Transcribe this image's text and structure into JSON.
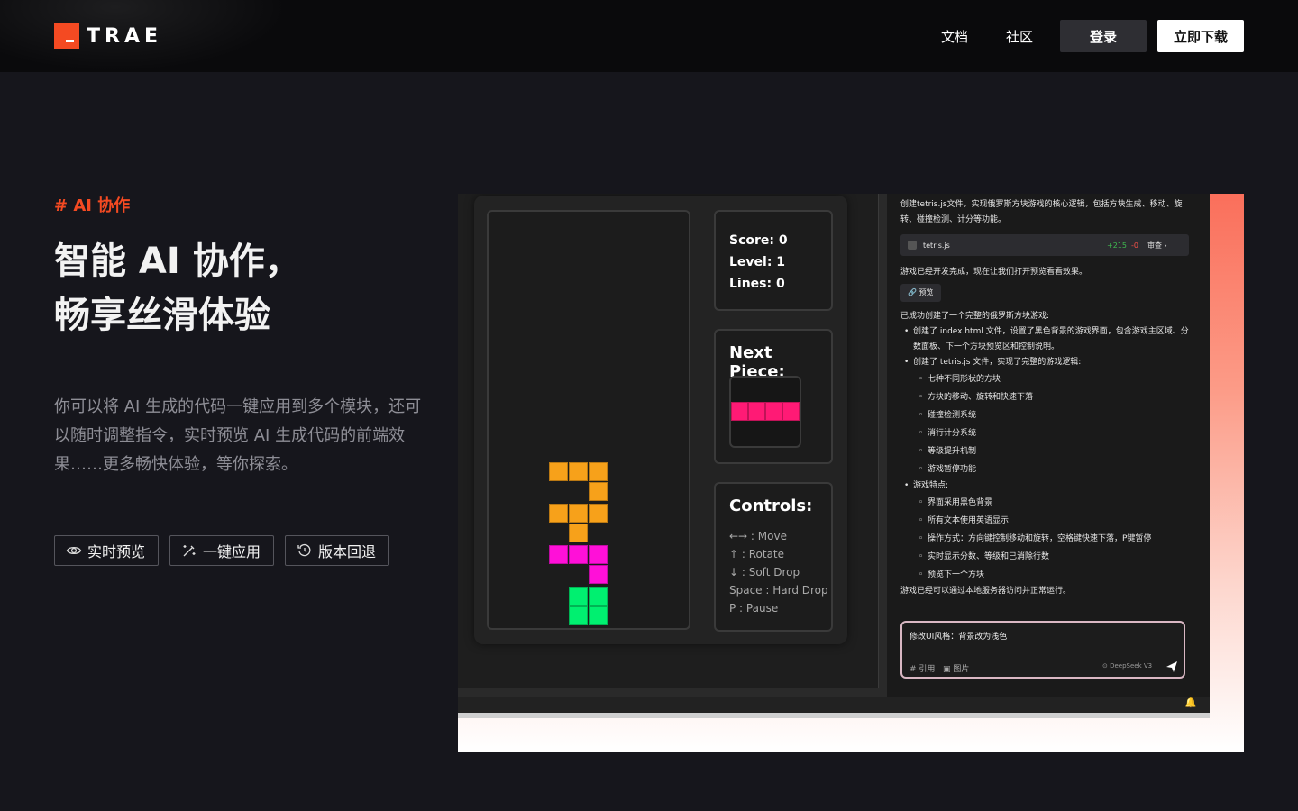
{
  "header": {
    "logo_text": "TRAE",
    "nav": [
      "文档",
      "社区"
    ],
    "login_label": "登录",
    "download_label": "立即下载",
    "brand_color": "#f44a22"
  },
  "hero": {
    "tag": "# AI 协作",
    "title_line1": "智能 AI 协作，",
    "title_line2": "畅享丝滑体验",
    "description": "你可以将 AI 生成的代码一键应用到多个模块，还可以随时调整指令，实时预览 AI 生成代码的前端效果……更多畅快体验，等你探索。",
    "features": [
      {
        "label": "实时预览",
        "icon": "eye-icon"
      },
      {
        "label": "一键应用",
        "icon": "magic-wand-icon"
      },
      {
        "label": "版本回退",
        "icon": "history-icon"
      }
    ]
  },
  "screenshot": {
    "game": {
      "score": "Score: 0",
      "level": "Level: 1",
      "lines": "Lines: 0",
      "next_title": "Next Piece:",
      "controls_title": "Controls:",
      "controls": [
        "←→ : Move",
        "↑ : Rotate",
        "↓ : Soft Drop",
        "Space : Hard Drop",
        "P : Pause"
      ],
      "colors": {
        "orange": "#f7a11a",
        "magenta": "#ff10d8",
        "green": "#00f070",
        "pink": "#ff1a75"
      }
    },
    "chat": {
      "intro": "创建tetris.js文件，实现俄罗斯方块游戏的核心逻辑，包括方块生成、移动、旋转、碰撞检测、计分等功能。",
      "file_name": "tetris.js",
      "diff_add": "+215",
      "diff_del": "-0",
      "review": "审查",
      "dev_done": "游戏已经开发完成，现在让我们打开预览看看效果。",
      "preview_label": "预览",
      "summary": "已成功创建了一个完整的俄罗斯方块游戏:",
      "item1": "创建了 index.html 文件，设置了黑色背景的游戏界面，包含游戏主区域、分数面板、下一个方块预览区和控制说明。",
      "item2": "创建了 tetris.js 文件，实现了完整的游戏逻辑:",
      "item2_subs": [
        "七种不同形状的方块",
        "方块的移动、旋转和快速下落",
        "碰撞检测系统",
        "消行计分系统",
        "等级提升机制",
        "游戏暂停功能"
      ],
      "item3": "游戏特点:",
      "item3_subs": [
        "界面采用黑色背景",
        "所有文本使用英语显示",
        "操作方式：方向键控制移动和旋转，空格键快速下落，P键暂停",
        "实时显示分数、等级和已消除行数",
        "预览下一个方块"
      ],
      "closing": "游戏已经可以通过本地服务器访问并正常运行。",
      "input_text": "修改UI风格：背景改为浅色",
      "tool_ref": "# 引用",
      "tool_image": "图片",
      "model": "DeepSeek V3"
    }
  }
}
